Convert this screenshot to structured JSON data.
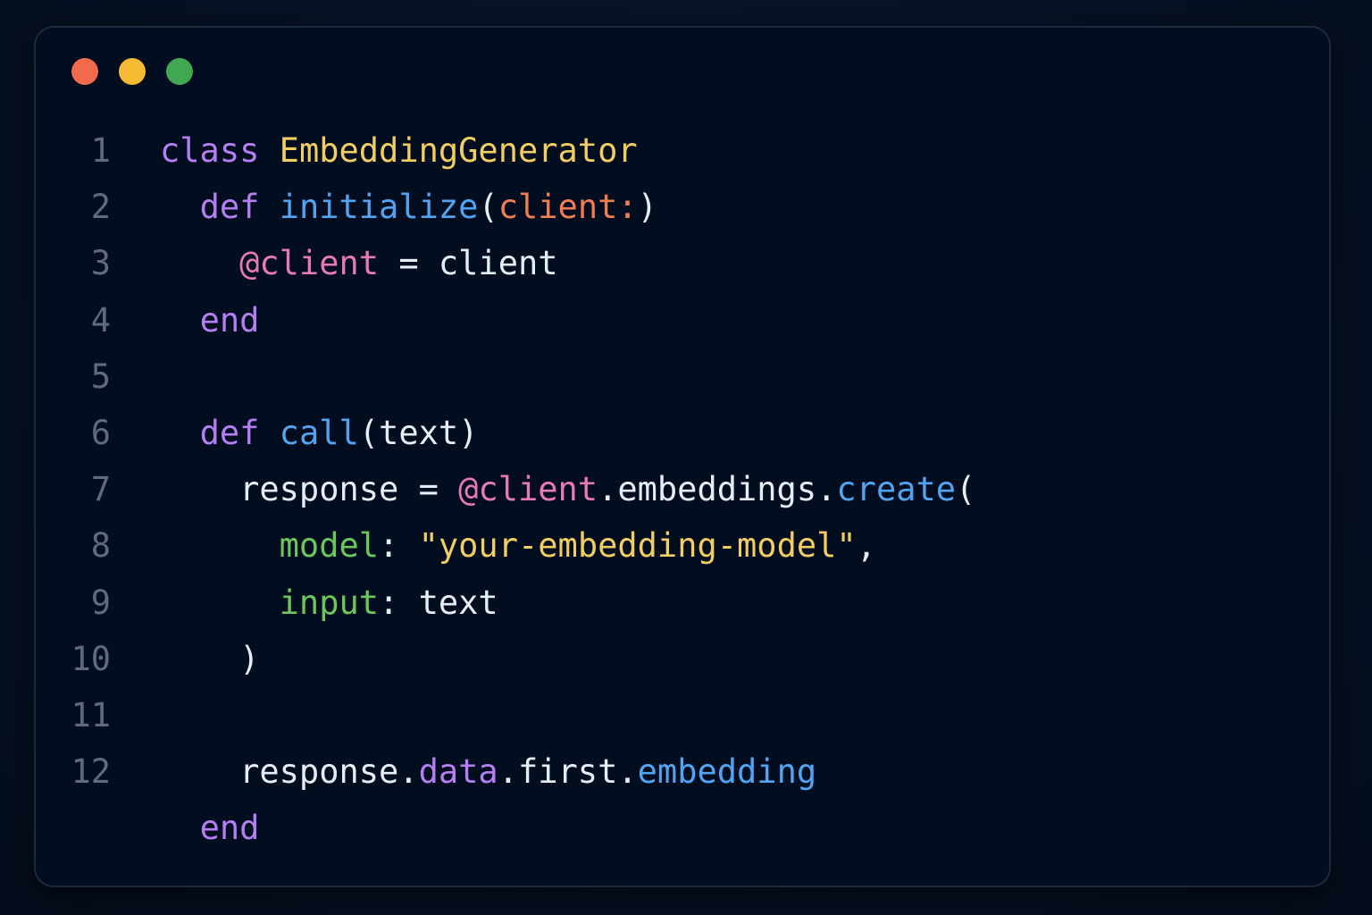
{
  "window": {
    "controls": [
      {
        "name": "close-button",
        "color": "#f26a4b"
      },
      {
        "name": "minimize-button",
        "color": "#f6bb33"
      },
      {
        "name": "maximize-button",
        "color": "#41a750"
      }
    ]
  },
  "code": {
    "language": "ruby",
    "lines": [
      {
        "number": "1",
        "tokens": [
          {
            "text": "class",
            "type": "kw"
          },
          {
            "text": " ",
            "type": "plain"
          },
          {
            "text": "EmbeddingGenerator",
            "type": "cls"
          }
        ]
      },
      {
        "number": "2",
        "tokens": [
          {
            "text": "  ",
            "type": "plain"
          },
          {
            "text": "def",
            "type": "kw"
          },
          {
            "text": " ",
            "type": "plain"
          },
          {
            "text": "initialize",
            "type": "fn"
          },
          {
            "text": "(",
            "type": "plain"
          },
          {
            "text": "client:",
            "type": "sym"
          },
          {
            "text": ")",
            "type": "plain"
          }
        ]
      },
      {
        "number": "3",
        "tokens": [
          {
            "text": "    ",
            "type": "plain"
          },
          {
            "text": "@client",
            "type": "ivar"
          },
          {
            "text": " = client",
            "type": "plain"
          }
        ]
      },
      {
        "number": "4",
        "tokens": [
          {
            "text": "  ",
            "type": "plain"
          },
          {
            "text": "end",
            "type": "kw"
          }
        ]
      },
      {
        "number": "5",
        "tokens": []
      },
      {
        "number": "6",
        "tokens": [
          {
            "text": "  ",
            "type": "plain"
          },
          {
            "text": "def",
            "type": "kw"
          },
          {
            "text": " ",
            "type": "plain"
          },
          {
            "text": "call",
            "type": "fn"
          },
          {
            "text": "(text)",
            "type": "plain"
          }
        ]
      },
      {
        "number": "7",
        "tokens": [
          {
            "text": "    response = ",
            "type": "plain"
          },
          {
            "text": "@client",
            "type": "ivar"
          },
          {
            "text": ".embeddings.",
            "type": "plain"
          },
          {
            "text": "create",
            "type": "fn"
          },
          {
            "text": "(",
            "type": "plain"
          }
        ]
      },
      {
        "number": "8",
        "tokens": [
          {
            "text": "      ",
            "type": "plain"
          },
          {
            "text": "model",
            "type": "key"
          },
          {
            "text": ": ",
            "type": "plain"
          },
          {
            "text": "\"your-embedding-model\"",
            "type": "str"
          },
          {
            "text": ",",
            "type": "plain"
          }
        ]
      },
      {
        "number": "9",
        "tokens": [
          {
            "text": "      ",
            "type": "plain"
          },
          {
            "text": "input",
            "type": "key"
          },
          {
            "text": ": text",
            "type": "plain"
          }
        ]
      },
      {
        "number": "10",
        "tokens": [
          {
            "text": "    )",
            "type": "plain"
          }
        ]
      },
      {
        "number": "11",
        "tokens": []
      },
      {
        "number": "12",
        "tokens": [
          {
            "text": "    response.",
            "type": "plain"
          },
          {
            "text": "data",
            "type": "prop"
          },
          {
            "text": ".first.",
            "type": "plain"
          },
          {
            "text": "embedding",
            "type": "fn"
          }
        ]
      },
      {
        "number": "",
        "tokens": [
          {
            "text": "  ",
            "type": "plain"
          },
          {
            "text": "end",
            "type": "kw"
          }
        ]
      }
    ]
  }
}
